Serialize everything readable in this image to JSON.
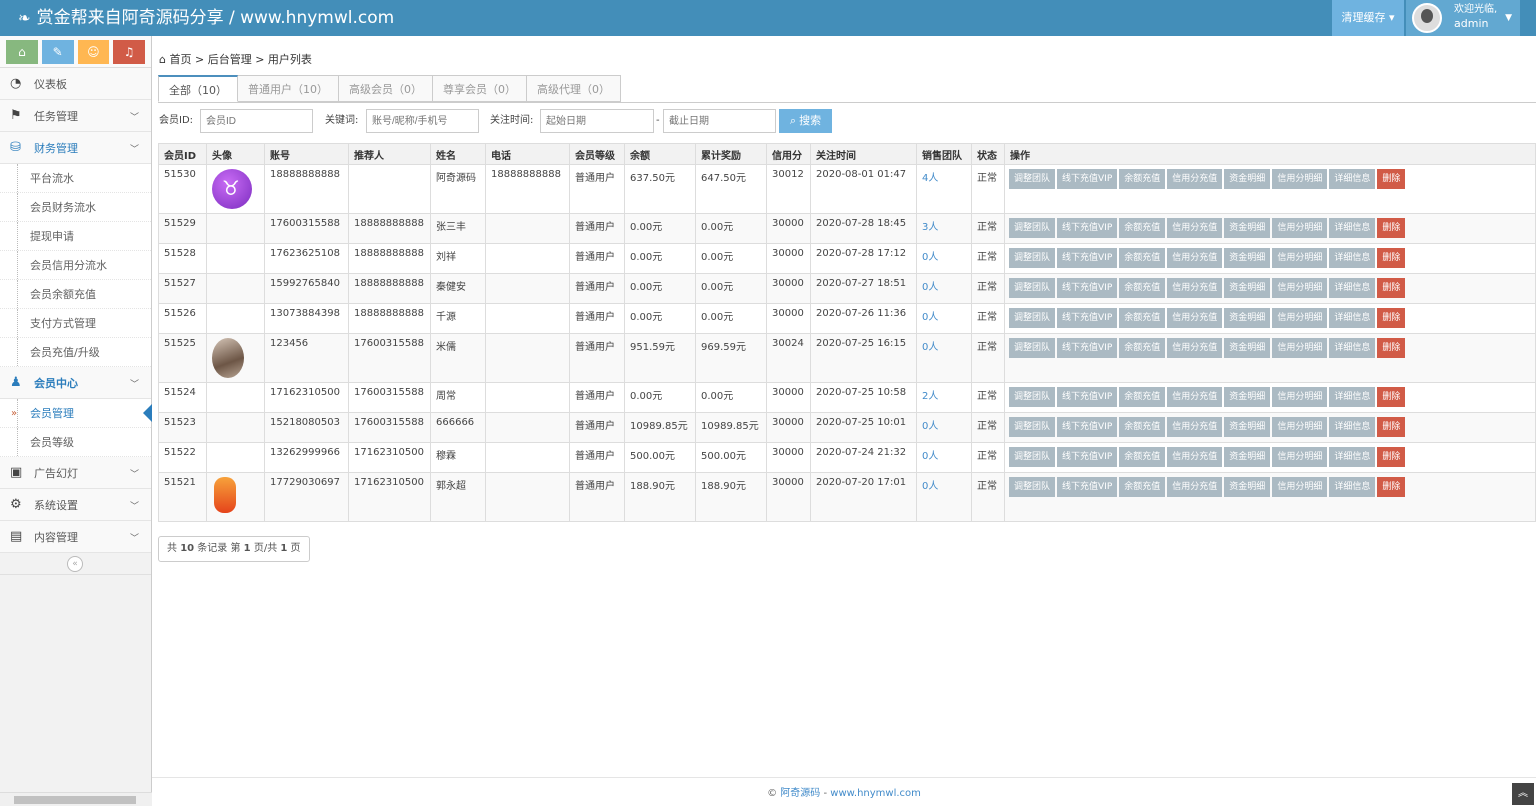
{
  "header": {
    "brand": "赏金帮来自阿奇源码分享 / www.hnymwl.com",
    "clear_cache": "清理缓存",
    "welcome": "欢迎光临,",
    "username": "admin"
  },
  "sidebar": {
    "items": [
      {
        "label": "仪表板",
        "icon": "dashboard-icon",
        "glyph": "◔"
      },
      {
        "label": "任务管理",
        "icon": "flag-icon",
        "glyph": "⚑"
      },
      {
        "label": "财务管理",
        "icon": "inbox-icon",
        "glyph": "⛁"
      }
    ],
    "finance_sub": [
      "平台流水",
      "会员财务流水",
      "提现申请",
      "会员信用分流水",
      "会员余额充值",
      "支付方式管理",
      "会员充值/升级"
    ],
    "member_center": "会员中心",
    "member_sub": [
      "会员管理",
      "会员等级"
    ],
    "bottom_items": [
      {
        "label": "广告幻灯",
        "glyph": "▣"
      },
      {
        "label": "系统设置",
        "glyph": "⚙"
      },
      {
        "label": "内容管理",
        "glyph": "▤"
      }
    ]
  },
  "breadcrumb": {
    "home": "首页",
    "section": "后台管理",
    "page": "用户列表"
  },
  "tabs": [
    "全部（10）",
    "普通用户（10）",
    "高级会员（0）",
    "尊享会员（0）",
    "高级代理（0）"
  ],
  "filters": {
    "member_id_label": "会员ID:",
    "member_id_placeholder": "会员ID",
    "keyword_label": "关键词:",
    "keyword_placeholder": "账号/昵称/手机号",
    "time_label": "关注时间:",
    "start_placeholder": "起始日期",
    "end_placeholder": "截止日期",
    "dash": "-",
    "search_label": "搜索"
  },
  "table": {
    "headers": [
      "会员ID",
      "头像",
      "账号",
      "推荐人",
      "姓名",
      "电话",
      "会员等级",
      "余额",
      "累计奖励",
      "信用分",
      "关注时间",
      "销售团队",
      "状态",
      "操作"
    ],
    "actions": [
      "调整团队",
      "线下充值VIP",
      "余额充值",
      "信用分充值",
      "资金明细",
      "信用分明细",
      "详细信息",
      "删除"
    ],
    "rows": [
      {
        "id": "51530",
        "avatar": "bull",
        "account": "18888888888",
        "referrer": "",
        "name": "阿奇源码",
        "phone": "18888888888",
        "level": "普通用户",
        "balance": "637.50元",
        "reward": "647.50元",
        "credit": "30012",
        "time": "2020-08-01 01:47",
        "team": "4人",
        "status": "正常"
      },
      {
        "id": "51529",
        "avatar": "",
        "account": "17600315588",
        "referrer": "18888888888",
        "name": "张三丰",
        "phone": "",
        "level": "普通用户",
        "balance": "0.00元",
        "reward": "0.00元",
        "credit": "30000",
        "time": "2020-07-28 18:45",
        "team": "3人",
        "status": "正常"
      },
      {
        "id": "51528",
        "avatar": "",
        "account": "17623625108",
        "referrer": "18888888888",
        "name": "刘祥",
        "phone": "",
        "level": "普通用户",
        "balance": "0.00元",
        "reward": "0.00元",
        "credit": "30000",
        "time": "2020-07-28 17:12",
        "team": "0人",
        "status": "正常"
      },
      {
        "id": "51527",
        "avatar": "",
        "account": "15992765840",
        "referrer": "18888888888",
        "name": "秦健安",
        "phone": "",
        "level": "普通用户",
        "balance": "0.00元",
        "reward": "0.00元",
        "credit": "30000",
        "time": "2020-07-27 18:51",
        "team": "0人",
        "status": "正常"
      },
      {
        "id": "51526",
        "avatar": "",
        "account": "13073884398",
        "referrer": "18888888888",
        "name": "千源",
        "phone": "",
        "level": "普通用户",
        "balance": "0.00元",
        "reward": "0.00元",
        "credit": "30000",
        "time": "2020-07-26 11:36",
        "team": "0人",
        "status": "正常"
      },
      {
        "id": "51525",
        "avatar": "photo",
        "account": "123456",
        "referrer": "17600315588",
        "name": "米儒",
        "phone": "",
        "level": "普通用户",
        "balance": "951.59元",
        "reward": "969.59元",
        "credit": "30024",
        "time": "2020-07-25 16:15",
        "team": "0人",
        "status": "正常"
      },
      {
        "id": "51524",
        "avatar": "",
        "account": "17162310500",
        "referrer": "17600315588",
        "name": "周常",
        "phone": "",
        "level": "普通用户",
        "balance": "0.00元",
        "reward": "0.00元",
        "credit": "30000",
        "time": "2020-07-25 10:58",
        "team": "2人",
        "status": "正常"
      },
      {
        "id": "51523",
        "avatar": "",
        "account": "15218080503",
        "referrer": "17600315588",
        "name": "666666",
        "phone": "",
        "level": "普通用户",
        "balance": "10989.85元",
        "reward": "10989.85元",
        "credit": "30000",
        "time": "2020-07-25 10:01",
        "team": "0人",
        "status": "正常"
      },
      {
        "id": "51522",
        "avatar": "",
        "account": "13262999966",
        "referrer": "17162310500",
        "name": "穆霖",
        "phone": "",
        "level": "普通用户",
        "balance": "500.00元",
        "reward": "500.00元",
        "credit": "30000",
        "time": "2020-07-24 21:32",
        "team": "0人",
        "status": "正常"
      },
      {
        "id": "51521",
        "avatar": "orange",
        "account": "17729030697",
        "referrer": "17162310500",
        "name": "郭永超",
        "phone": "",
        "level": "普通用户",
        "balance": "188.90元",
        "reward": "188.90元",
        "credit": "30000",
        "time": "2020-07-20 17:01",
        "team": "0人",
        "status": "正常"
      }
    ]
  },
  "pager": {
    "prefix": "共",
    "total": "10",
    "mid": "条记录 第",
    "page": "1",
    "sep": "页/共",
    "pages": "1",
    "suffix": "页"
  },
  "footer": {
    "copyright": "©",
    "site_name": "阿奇源码",
    "dash": "-",
    "site_url": "www.hnymwl.com"
  },
  "colors": {
    "header": "#438eb9",
    "accent": "#6fb3e0",
    "danger": "#d15b47",
    "action": "#abbac3"
  }
}
